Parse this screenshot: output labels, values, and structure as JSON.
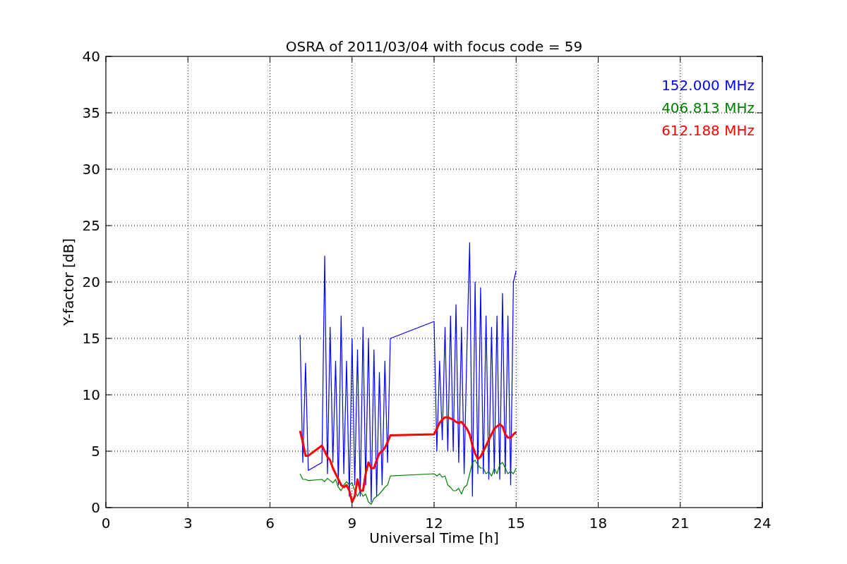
{
  "chart_data": {
    "type": "line",
    "title": "OSRA of 2011/03/04 with focus code = 59",
    "xlabel": "Universal Time [h]",
    "ylabel": "Y-factor [dB]",
    "x": [
      7.1,
      7.2,
      7.3,
      7.4,
      7.9,
      8.0,
      8.1,
      8.2,
      8.3,
      8.4,
      8.5,
      8.6,
      8.7,
      8.8,
      8.9,
      9.0,
      9.1,
      9.2,
      9.3,
      9.4,
      9.5,
      9.6,
      9.7,
      9.8,
      9.9,
      10.0,
      10.1,
      10.2,
      10.3,
      10.4,
      12.0,
      12.1,
      12.2,
      12.3,
      12.4,
      12.5,
      12.6,
      12.7,
      12.8,
      12.9,
      13.0,
      13.1,
      13.2,
      13.3,
      13.4,
      13.5,
      13.6,
      13.7,
      13.8,
      13.9,
      14.0,
      14.1,
      14.2,
      14.3,
      14.4,
      14.5,
      14.6,
      14.7,
      14.8,
      14.9,
      15.0
    ],
    "series": [
      {
        "name": "152.000 MHz",
        "color": "#0000ff",
        "values": [
          15.3,
          4,
          12.8,
          3.3,
          4,
          22.3,
          3,
          16,
          4,
          13,
          2,
          17,
          3,
          13,
          1,
          15,
          2,
          14,
          1,
          16,
          2,
          15,
          0.5,
          14,
          1,
          12,
          2,
          13,
          4,
          15,
          16.5,
          5,
          13,
          6,
          16,
          5,
          17,
          5,
          18,
          4,
          16,
          3,
          14,
          23.5,
          1,
          20,
          3,
          19.5,
          3,
          17,
          2.5,
          16,
          3,
          17,
          2.5,
          19,
          3,
          17,
          2,
          20,
          21
        ]
      },
      {
        "name": "406.813 MHz",
        "color": "#008000",
        "values": [
          3,
          2.5,
          2.5,
          2.4,
          2.5,
          2.3,
          2.6,
          2.4,
          2.2,
          2.5,
          1.8,
          1.5,
          2,
          2.3,
          2,
          2.2,
          1.5,
          1,
          1.5,
          1,
          1.2,
          0.5,
          0.3,
          0.8,
          1,
          1.2,
          1.5,
          1.8,
          2,
          2.8,
          3,
          2.8,
          3,
          2.7,
          2.8,
          2,
          1.8,
          1.5,
          1.5,
          1.7,
          1.2,
          1.8,
          2,
          3,
          4,
          4.2,
          3.8,
          3.5,
          3.5,
          3,
          3.2,
          2.8,
          3.5,
          3,
          3.8,
          4,
          3.5,
          3,
          3.2,
          3,
          3.5
        ]
      },
      {
        "name": "612.188 MHz",
        "color": "#ff0000",
        "values": [
          6.8,
          5.8,
          4.6,
          4.6,
          5.5,
          5,
          4.5,
          4.2,
          3.5,
          3,
          2.5,
          2,
          1.8,
          2,
          1.5,
          0.5,
          1,
          2.5,
          1.5,
          1.5,
          3,
          4,
          3.5,
          3.5,
          4.2,
          4.8,
          5,
          5.3,
          5.8,
          6.4,
          6.5,
          7,
          7.5,
          7.8,
          8,
          8,
          7.9,
          7.8,
          7.6,
          7.5,
          7.6,
          7.3,
          7,
          6.5,
          5.5,
          4.8,
          4.3,
          4.5,
          5,
          5.5,
          6,
          6.5,
          7,
          7.2,
          7.4,
          7.2,
          6.5,
          6.2,
          6.2,
          6.5,
          6.7
        ]
      }
    ],
    "grid": true,
    "xlim": [
      0,
      24
    ],
    "ylim": [
      0,
      40
    ],
    "xticks": [
      0,
      3,
      6,
      9,
      12,
      15,
      18,
      21,
      24
    ],
    "yticks": [
      0,
      5,
      10,
      15,
      20,
      25,
      30,
      35,
      40
    ]
  }
}
